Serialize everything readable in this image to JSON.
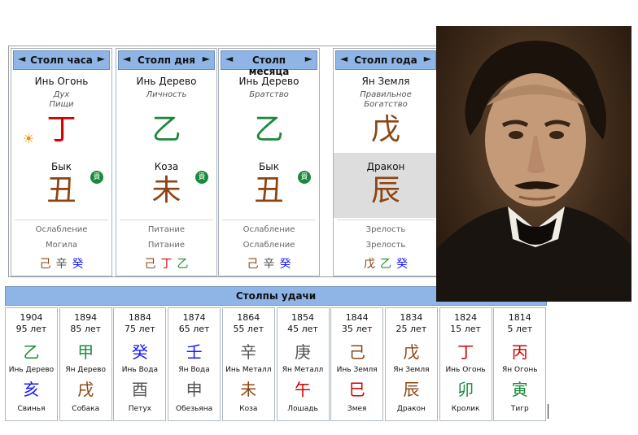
{
  "pillars": [
    {
      "title": "Столп часа",
      "stem_name": "Инь Огонь",
      "god": "Дух\nПищи",
      "stem_char": "丁",
      "stem_color": "#d40000",
      "branch_name": "Бык",
      "branch_char": "丑",
      "branch_color": "#8b4513",
      "noble_icon": "貴",
      "stage1": "Ослабление",
      "stage2": "Могила",
      "hidden": [
        {
          "char": "己",
          "color": "#8b4513"
        },
        {
          "char": "辛",
          "color": "#555555"
        },
        {
          "char": "癸",
          "color": "#1a1aff"
        }
      ]
    },
    {
      "title": "Столп дня",
      "stem_name": "Инь Дерево",
      "god": "Личность",
      "stem_char": "乙",
      "stem_color": "#1a8a3a",
      "branch_name": "Коза",
      "branch_char": "未",
      "branch_color": "#8b4513",
      "noble_icon": "貴",
      "stage1": "Питание",
      "stage2": "Питание",
      "hidden": [
        {
          "char": "己",
          "color": "#8b4513"
        },
        {
          "char": "丁",
          "color": "#d40000"
        },
        {
          "char": "乙",
          "color": "#1a8a3a"
        }
      ]
    },
    {
      "title": "Столп месяца",
      "stem_name": "Инь Дерево",
      "god": "Братство",
      "stem_char": "乙",
      "stem_color": "#1a8a3a",
      "branch_name": "Бык",
      "branch_char": "丑",
      "branch_color": "#8b4513",
      "noble_icon": "貴",
      "stage1": "Ослабление",
      "stage2": "Ослабление",
      "hidden": [
        {
          "char": "己",
          "color": "#8b4513"
        },
        {
          "char": "辛",
          "color": "#555555"
        },
        {
          "char": "癸",
          "color": "#1a1aff"
        }
      ]
    },
    {
      "title": "Столп года",
      "stem_name": "Ян Земля",
      "god": "Правильное\nБогатство",
      "stem_char": "戊",
      "stem_color": "#8b4513",
      "branch_name": "Дракон",
      "branch_char": "辰",
      "branch_color": "#8b4513",
      "noble_icon": "",
      "stage1": "Зрелость",
      "stage2": "Зрелость",
      "hidden": [
        {
          "char": "戊",
          "color": "#8b4513"
        },
        {
          "char": "乙",
          "color": "#1a8a3a"
        },
        {
          "char": "癸",
          "color": "#1a1aff"
        }
      ]
    }
  ],
  "nav": {
    "prev": "◄",
    "next": "►"
  },
  "hour_icon": "sun-icon",
  "luck": {
    "title": "Столпы удачи",
    "columns": [
      {
        "year": "1904",
        "age": "95 лет",
        "stem": "乙",
        "stem_color": "#1a8a3a",
        "stem_name": "Инь Дерево",
        "branch": "亥",
        "branch_color": "#1a1aff",
        "branch_name": "Свинья"
      },
      {
        "year": "1894",
        "age": "85 лет",
        "stem": "甲",
        "stem_color": "#1a8a3a",
        "stem_name": "Ян Дерево",
        "branch": "戌",
        "branch_color": "#8b4513",
        "branch_name": "Собака"
      },
      {
        "year": "1884",
        "age": "75 лет",
        "stem": "癸",
        "stem_color": "#1a1aff",
        "stem_name": "Инь Вода",
        "branch": "酉",
        "branch_color": "#555555",
        "branch_name": "Петух"
      },
      {
        "year": "1874",
        "age": "65 лет",
        "stem": "壬",
        "stem_color": "#1a1aff",
        "stem_name": "Ян Вода",
        "branch": "申",
        "branch_color": "#555555",
        "branch_name": "Обезьяна"
      },
      {
        "year": "1864",
        "age": "55 лет",
        "stem": "辛",
        "stem_color": "#555555",
        "stem_name": "Инь Металл",
        "branch": "未",
        "branch_color": "#8b4513",
        "branch_name": "Коза"
      },
      {
        "year": "1854",
        "age": "45 лет",
        "stem": "庚",
        "stem_color": "#555555",
        "stem_name": "Ян Металл",
        "branch": "午",
        "branch_color": "#d40000",
        "branch_name": "Лошадь"
      },
      {
        "year": "1844",
        "age": "35 лет",
        "stem": "己",
        "stem_color": "#8b4513",
        "stem_name": "Инь Земля",
        "branch": "巳",
        "branch_color": "#d40000",
        "branch_name": "Змея"
      },
      {
        "year": "1834",
        "age": "25 лет",
        "stem": "戊",
        "stem_color": "#8b4513",
        "stem_name": "Ян Земля",
        "branch": "辰",
        "branch_color": "#8b4513",
        "branch_name": "Дракон"
      },
      {
        "year": "1824",
        "age": "15 лет",
        "stem": "丁",
        "stem_color": "#d40000",
        "stem_name": "Инь Огонь",
        "branch": "卯",
        "branch_color": "#1a8a3a",
        "branch_name": "Кролик"
      },
      {
        "year": "1814",
        "age": "5 лет",
        "stem": "丙",
        "stem_color": "#d40000",
        "stem_name": "Ян Огонь",
        "branch": "寅",
        "branch_color": "#1a8a3a",
        "branch_name": "Тигр"
      }
    ]
  }
}
